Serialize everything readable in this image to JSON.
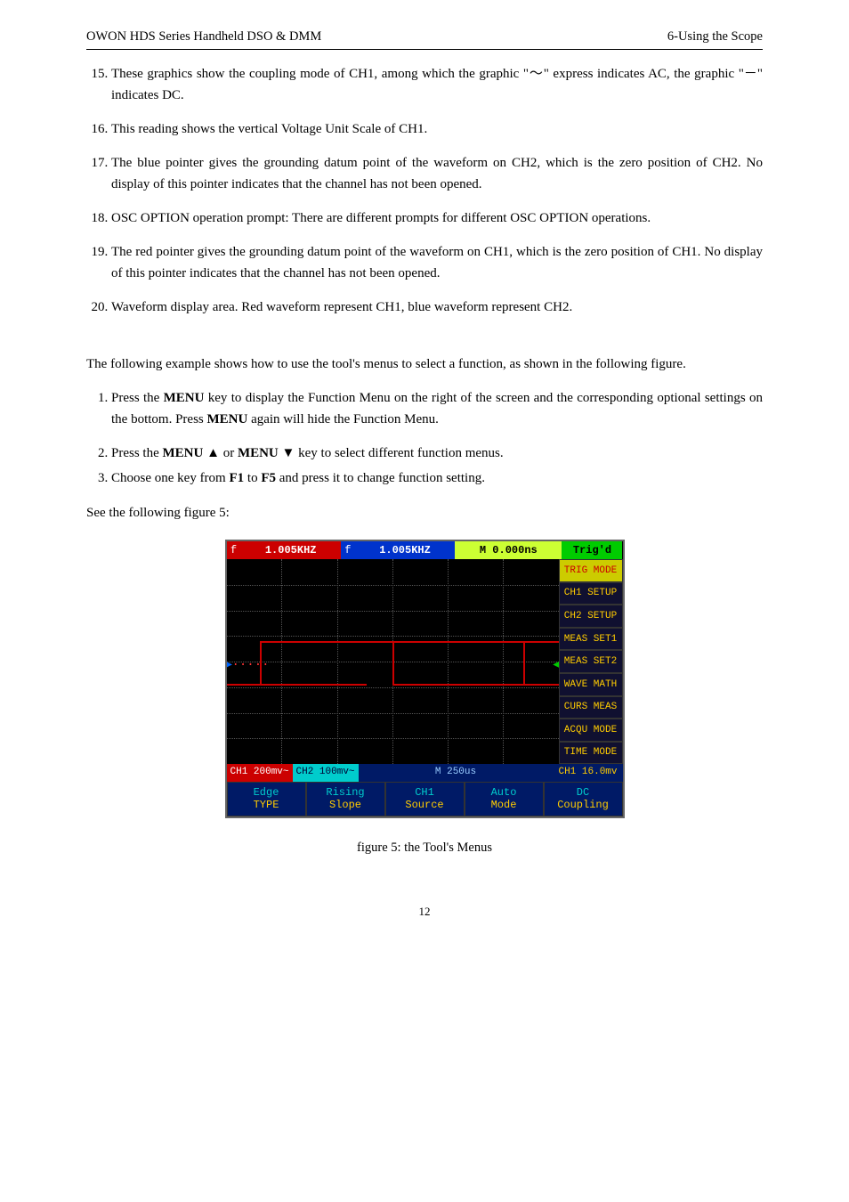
{
  "header": {
    "left": "OWON    HDS Series Handheld DSO & DMM",
    "right": "6-Using the Scope"
  },
  "items_cont": [
    "These graphics show the coupling mode of CH1, among which the graphic \"～\" express indicates AC, the graphic \"－\" indicates DC.",
    "This reading shows the vertical Voltage Unit Scale of CH1.",
    "The blue pointer gives the grounding datum point of the waveform on CH2, which is the zero position of CH2. No display of this pointer indicates that the channel has not been opened.",
    "OSC OPTION operation prompt: There are different prompts for different OSC OPTION operations.",
    "The red pointer gives the grounding datum point of the waveform on CH1, which is the zero position of CH1. No display of this pointer indicates that the channel has not been opened.",
    "Waveform display area. Red waveform represent CH1, blue waveform represent CH2."
  ],
  "para1": "The following example shows how to use the tool's menus to select a function, as shown in the following figure.",
  "steps": {
    "s1a": "Press the ",
    "s1b": "MENU",
    "s1c": " key to display the Function Menu on the right of the screen and the corresponding optional settings on the bottom. Press ",
    "s1d": "MENU",
    "s1e": " again will hide the Function Menu.",
    "s2a": "Press the ",
    "s2b": "MENU  ▲",
    "s2c": " or ",
    "s2d": "MENU  ▼",
    "s2e": " key to select different function menus.",
    "s3a": "Choose one key from ",
    "s3b": "F1",
    "s3c": " to ",
    "s3d": "F5",
    "s3e": " and press it to change function setting."
  },
  "para2": "See the following figure 5:",
  "scope": {
    "f1": "f",
    "f1t": " 1.005KHZ ",
    "f2": "f",
    "f2t": " 1.005KHZ ",
    "mpos": "M 0.000ns",
    "trigd": "Trig'd",
    "menu": [
      "TRIG MODE",
      "CH1 SETUP",
      "CH2 SETUP",
      "MEAS SET1",
      "MEAS SET2",
      "WAVE MATH",
      "CURS MEAS",
      "ACQU MODE",
      "TIME MODE"
    ],
    "low": {
      "c1": "CH1 200mv~",
      "c2": "CH2 100mv~",
      "c3": "M 250us",
      "c4": "CH1 16.0mv"
    },
    "btns": [
      {
        "t": "Edge",
        "s": "TYPE"
      },
      {
        "t": "Rising",
        "s": "Slope"
      },
      {
        "t": "CH1",
        "s": "Source"
      },
      {
        "t": "Auto",
        "s": "Mode"
      },
      {
        "t": "DC",
        "s": "Coupling"
      }
    ]
  },
  "caption": "figure 5: the Tool's Menus",
  "pagenum": "12"
}
